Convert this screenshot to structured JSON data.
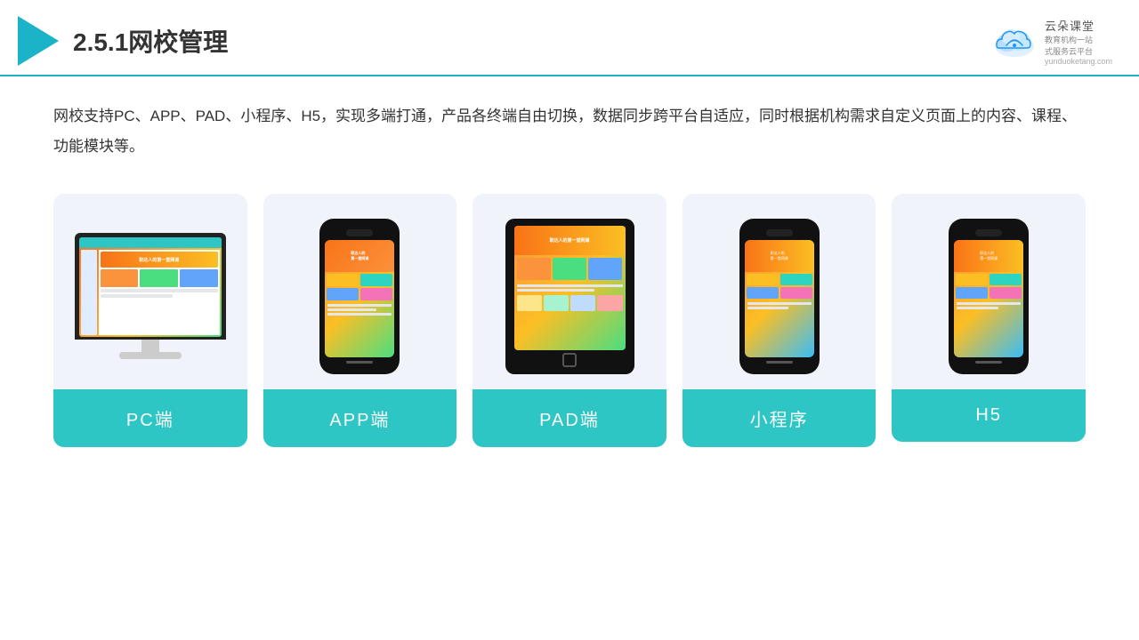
{
  "header": {
    "title": "2.5.1网校管理",
    "brand": {
      "name": "云朵课堂",
      "slogan": "教育机构一站\n式服务云平台",
      "url": "yunduoketang.com"
    }
  },
  "description": "网校支持PC、APP、PAD、小程序、H5，实现多端打通，产品各终端自由切换，数据同步跨平台自适应，同时根据机构需求自定义页面上的内容、课程、功能模块等。",
  "cards": [
    {
      "id": "pc",
      "label": "PC端"
    },
    {
      "id": "app",
      "label": "APP端"
    },
    {
      "id": "pad",
      "label": "PAD端"
    },
    {
      "id": "mini",
      "label": "小程序"
    },
    {
      "id": "h5",
      "label": "H5"
    }
  ],
  "accent_color": "#2ec5c5"
}
